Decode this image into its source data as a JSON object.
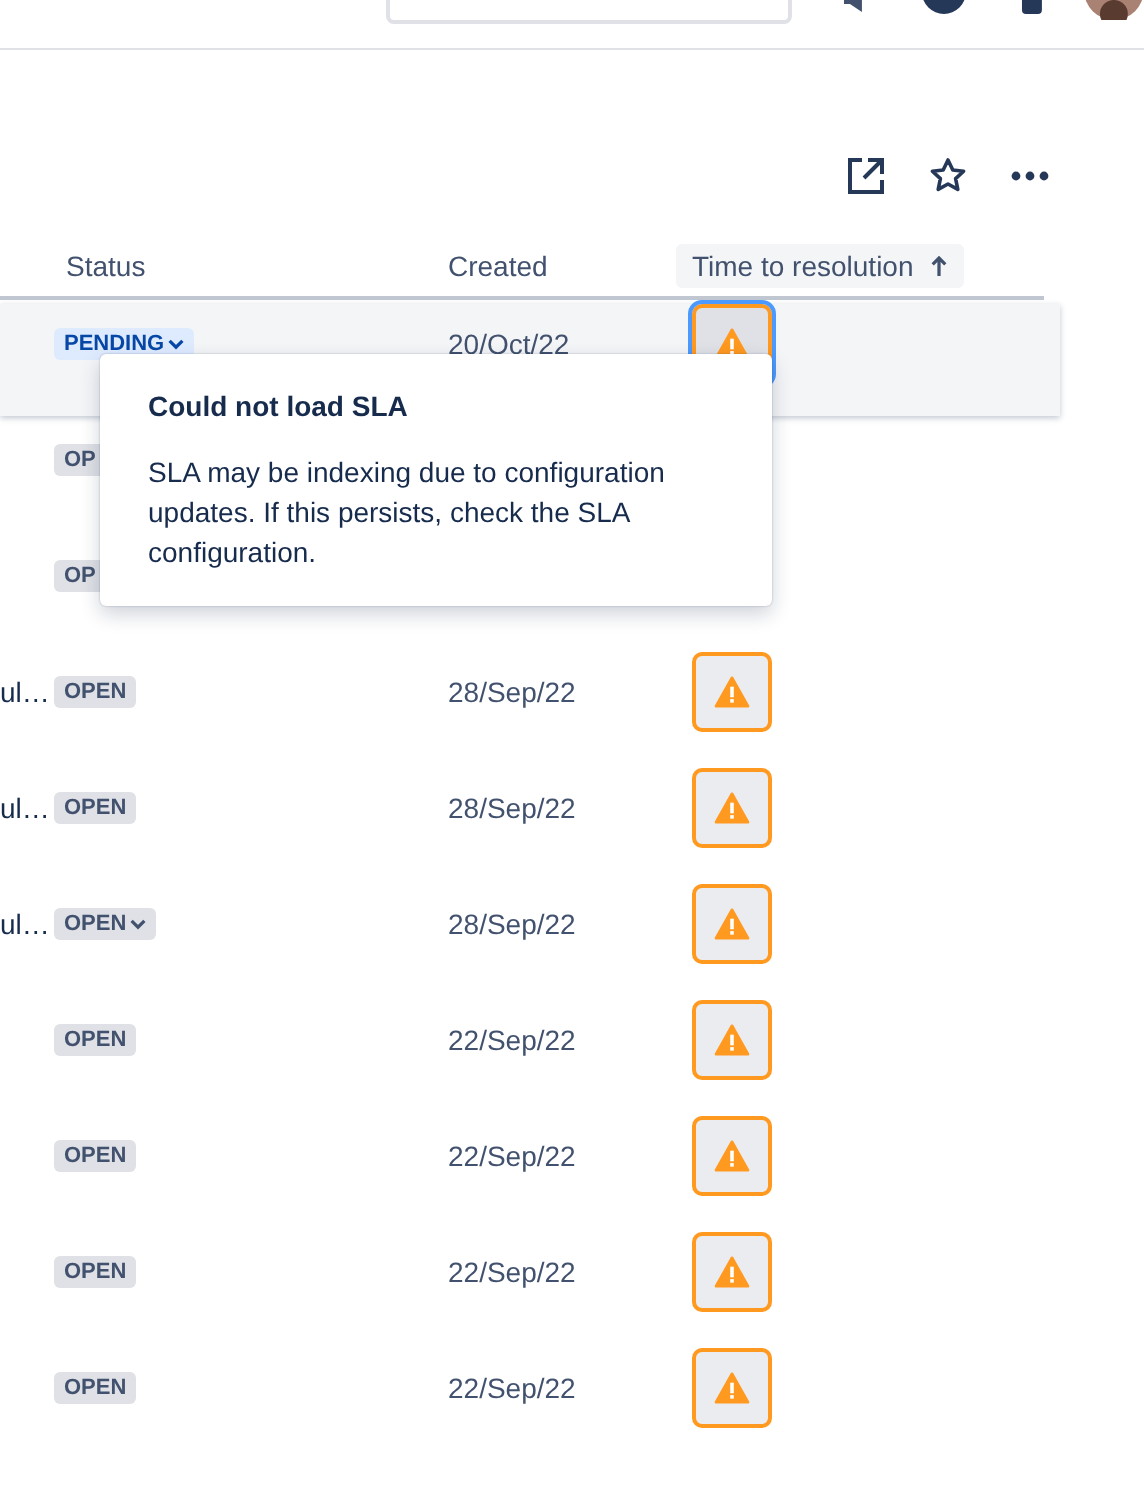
{
  "table": {
    "columns": [
      {
        "label": "Status",
        "sorted": false
      },
      {
        "label": "Created",
        "sorted": false
      },
      {
        "label": "Time to resolution",
        "sorted": true
      }
    ],
    "rows": [
      {
        "status": "PENDING",
        "in_progress": true,
        "dropdown": true,
        "created": "20/Oct/22",
        "sla_warning": true,
        "selected": true,
        "focused": true
      },
      {
        "status": "OP",
        "in_progress": false,
        "dropdown": false,
        "selected": false
      },
      {
        "status": "OP",
        "in_progress": false,
        "dropdown": false,
        "selected": false
      },
      {
        "summary": "ul…",
        "status": "OPEN",
        "in_progress": false,
        "dropdown": false,
        "created": "28/Sep/22",
        "sla_warning": true,
        "selected": false,
        "focused": false
      },
      {
        "summary": "ul…",
        "status": "OPEN",
        "in_progress": false,
        "dropdown": false,
        "created": "28/Sep/22",
        "sla_warning": true,
        "selected": false,
        "focused": false
      },
      {
        "summary": "ul…",
        "status": "OPEN",
        "in_progress": false,
        "dropdown": true,
        "created": "28/Sep/22",
        "sla_warning": true,
        "selected": false,
        "focused": false
      },
      {
        "status": "OPEN",
        "in_progress": false,
        "dropdown": false,
        "created": "22/Sep/22",
        "sla_warning": true,
        "selected": false,
        "focused": false
      },
      {
        "status": "OPEN",
        "in_progress": false,
        "dropdown": false,
        "created": "22/Sep/22",
        "sla_warning": true,
        "selected": false,
        "focused": false
      },
      {
        "status": "OPEN",
        "in_progress": false,
        "dropdown": false,
        "created": "22/Sep/22",
        "sla_warning": true,
        "selected": false,
        "focused": false
      },
      {
        "status": "OPEN",
        "in_progress": false,
        "dropdown": false,
        "created": "22/Sep/22",
        "sla_warning": true,
        "selected": false,
        "focused": false
      }
    ]
  },
  "tooltip": {
    "title": "Could not load SLA",
    "body": "SLA may be indexing due to configuration updates. If this persists, check the SLA configuration."
  }
}
